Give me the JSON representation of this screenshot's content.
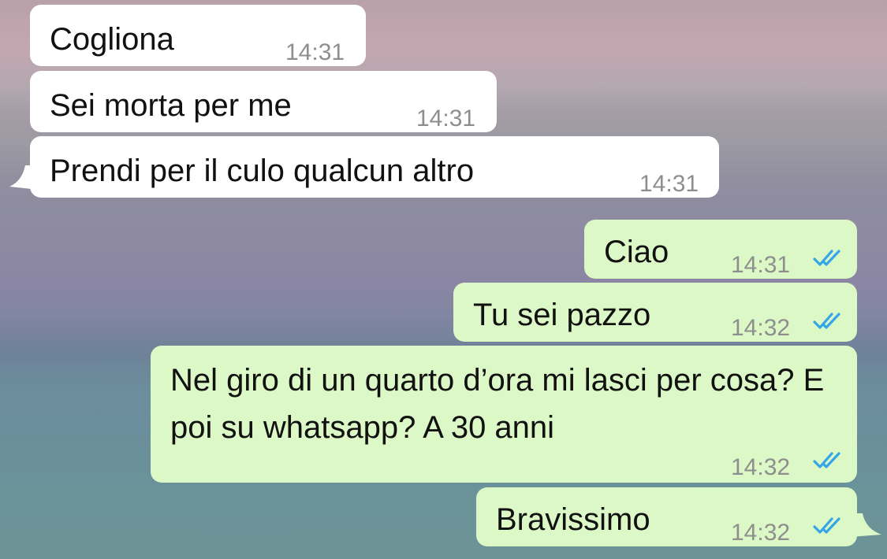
{
  "messages": [
    {
      "direction": "incoming",
      "text": "Cogliona",
      "time": "14:31"
    },
    {
      "direction": "incoming",
      "text": "Sei morta per me",
      "time": "14:31"
    },
    {
      "direction": "incoming",
      "text": "Prendi per il culo qualcun altro",
      "time": "14:31"
    },
    {
      "direction": "outgoing",
      "text": "Ciao",
      "time": "14:31",
      "status": "read"
    },
    {
      "direction": "outgoing",
      "text": "Tu sei pazzo",
      "time": "14:32",
      "status": "read"
    },
    {
      "direction": "outgoing",
      "text": "Nel giro di un quarto d’ora mi lasci per cosa? E poi su whatsapp? A 30 anni",
      "time": "14:32",
      "status": "read"
    },
    {
      "direction": "outgoing",
      "text": "Bravissimo",
      "time": "14:32",
      "status": "read"
    }
  ],
  "colors": {
    "incoming_bubble": "#ffffff",
    "outgoing_bubble": "#dcf8c6",
    "read_ticks": "#34a6e8",
    "timestamp": "#8e8e8e"
  },
  "icons": {
    "read_status": "double-check-icon"
  }
}
